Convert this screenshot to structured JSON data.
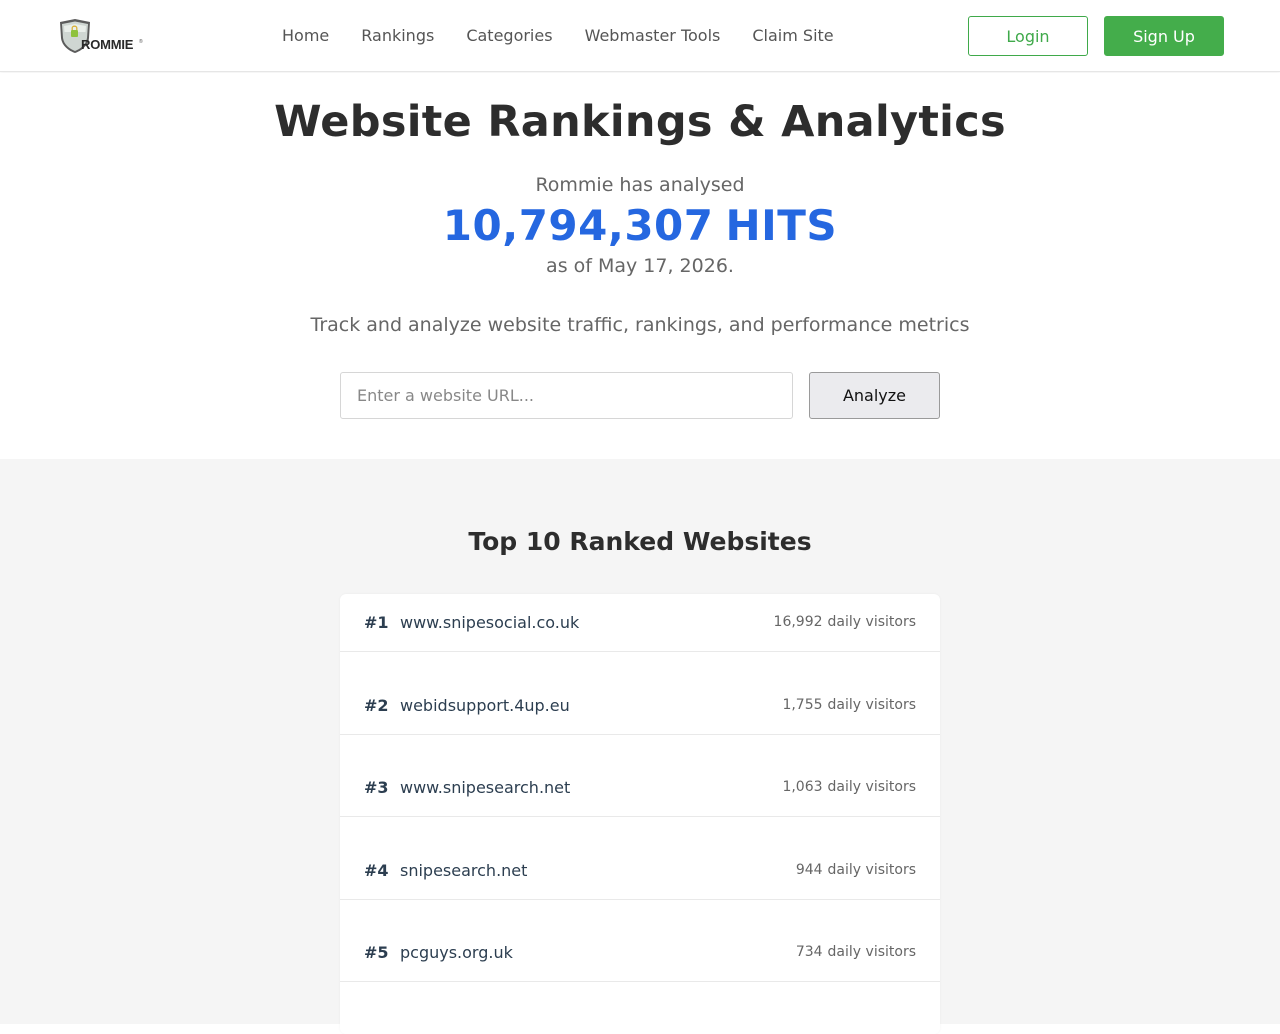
{
  "brand": {
    "name": "ROMMIE",
    "tm": "®",
    "logo_icon": "shield-logo"
  },
  "nav": {
    "links": [
      {
        "label": "Home"
      },
      {
        "label": "Rankings"
      },
      {
        "label": "Categories"
      },
      {
        "label": "Webmaster Tools"
      },
      {
        "label": "Claim Site"
      }
    ],
    "login_label": "Login",
    "signup_label": "Sign Up"
  },
  "hero": {
    "title": "Website Rankings & Analytics",
    "stat_intro": "Rommie has analysed",
    "stat_count": "10,794,307",
    "stat_unit": "HITS",
    "stat_date": "as of May 17, 2026.",
    "subtitle": "Track and analyze website traffic, rankings, and performance metrics",
    "search_placeholder": "Enter a website URL...",
    "search_value": "",
    "analyze_label": "Analyze"
  },
  "rankings": {
    "title": "Top 10 Ranked Websites",
    "visitors_unit": "daily visitors",
    "items": [
      {
        "rank": "#1",
        "site": "www.snipesocial.co.uk",
        "visitors": "16,992"
      },
      {
        "rank": "#2",
        "site": "webidsupport.4up.eu",
        "visitors": "1,755"
      },
      {
        "rank": "#3",
        "site": "www.snipesearch.net",
        "visitors": "1,063"
      },
      {
        "rank": "#4",
        "site": "snipesearch.net",
        "visitors": "944"
      },
      {
        "rank": "#5",
        "site": "pcguys.org.uk",
        "visitors": "734"
      }
    ]
  },
  "colors": {
    "accent_blue": "#2567e0",
    "green": "#44ad4b",
    "section_bg": "#f5f5f5",
    "text_dark": "#2c3e50"
  }
}
